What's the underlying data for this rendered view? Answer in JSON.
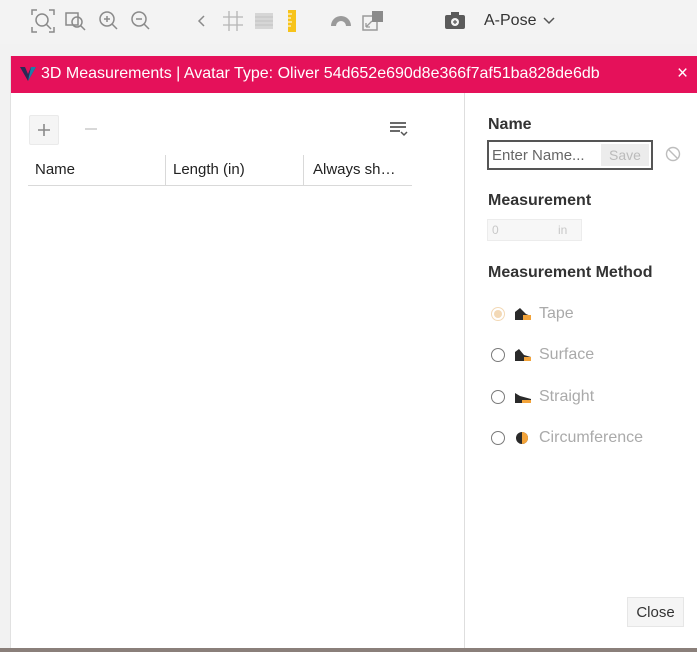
{
  "toolbar": {
    "pose_label": "A-Pose"
  },
  "dialog": {
    "title": "3D Measurements | Avatar Type: Oliver 54d652e690d8e366f7af51ba828de6db",
    "close_icon": "×"
  },
  "list": {
    "columns": [
      "Name",
      "Length (in)",
      "Always sh…"
    ]
  },
  "form": {
    "name_label": "Name",
    "name_placeholder": "Enter Name...",
    "save_label": "Save",
    "measurement_label": "Measurement",
    "measurement_value": "0",
    "measurement_unit": "in",
    "method_label": "Measurement Method",
    "methods": [
      {
        "label": "Tape",
        "selected": true,
        "disabled": true
      },
      {
        "label": "Surface",
        "selected": false,
        "disabled": false
      },
      {
        "label": "Straight",
        "selected": false,
        "disabled": false
      },
      {
        "label": "Circumference",
        "selected": false,
        "disabled": false
      }
    ],
    "close_label": "Close"
  },
  "colors": {
    "titlebar": "#e5115a",
    "accent_orange": "#f2a33a",
    "ruler_yellow": "#f7c31a"
  }
}
